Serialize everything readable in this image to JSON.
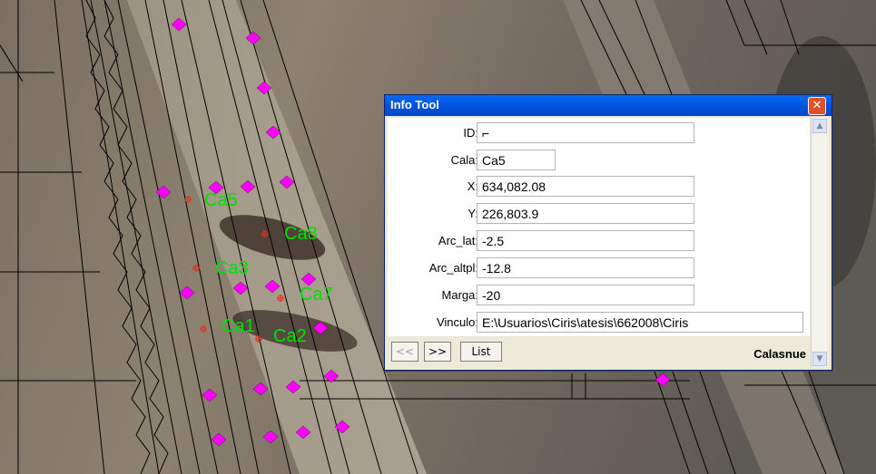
{
  "map": {
    "labels": [
      {
        "text": "Ca5"
      },
      {
        "text": "Ca8"
      },
      {
        "text": "Ca3"
      },
      {
        "text": "Ca7"
      },
      {
        "text": "Ca1"
      },
      {
        "text": "Ca2"
      }
    ],
    "colors": {
      "marker": "#FF00FF",
      "label": "#00E000",
      "crosshair": "#E03020"
    }
  },
  "info_tool": {
    "title": "Info Tool",
    "close_icon": "close-icon",
    "fields": [
      {
        "label": "ID:",
        "value": "⌐"
      },
      {
        "label": "Cala:",
        "value": "Ca5"
      },
      {
        "label": "X:",
        "value": "634,082.08"
      },
      {
        "label": "Y:",
        "value": "226,803.9"
      },
      {
        "label": "Arc_lat:",
        "value": "-2.5"
      },
      {
        "label": "Arc_altpl:",
        "value": "-12.8"
      },
      {
        "label": "Marga:",
        "value": "-20"
      },
      {
        "label": "Vinculo:",
        "value": "E:\\Usuarios\\Ciris\\atesis\\662008\\Ciris"
      }
    ],
    "buttons": {
      "prev": "<<",
      "next": ">>",
      "list": "List"
    },
    "layer_name": "Calasnue"
  }
}
